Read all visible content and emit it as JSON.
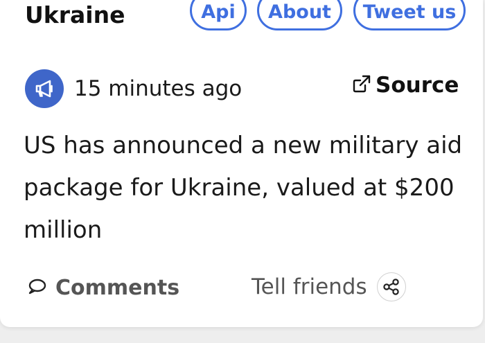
{
  "header": {
    "title": "Ukraine",
    "nav": {
      "api": "Api",
      "about": "About",
      "tweet": "Tweet us"
    },
    "accent_color": "#3f6fe0"
  },
  "post": {
    "avatar_icon": "megaphone-icon",
    "time": "15 minutes ago",
    "source_label": "Source",
    "source_icon": "external-link-icon",
    "text": "US has announced a new military aid package for Ukraine, valued at $200 million"
  },
  "actions": {
    "comments_label": "Comments",
    "comments_icon": "comment-bubble-icon",
    "tell_label": "Tell friends",
    "share_icon": "share-icon"
  }
}
